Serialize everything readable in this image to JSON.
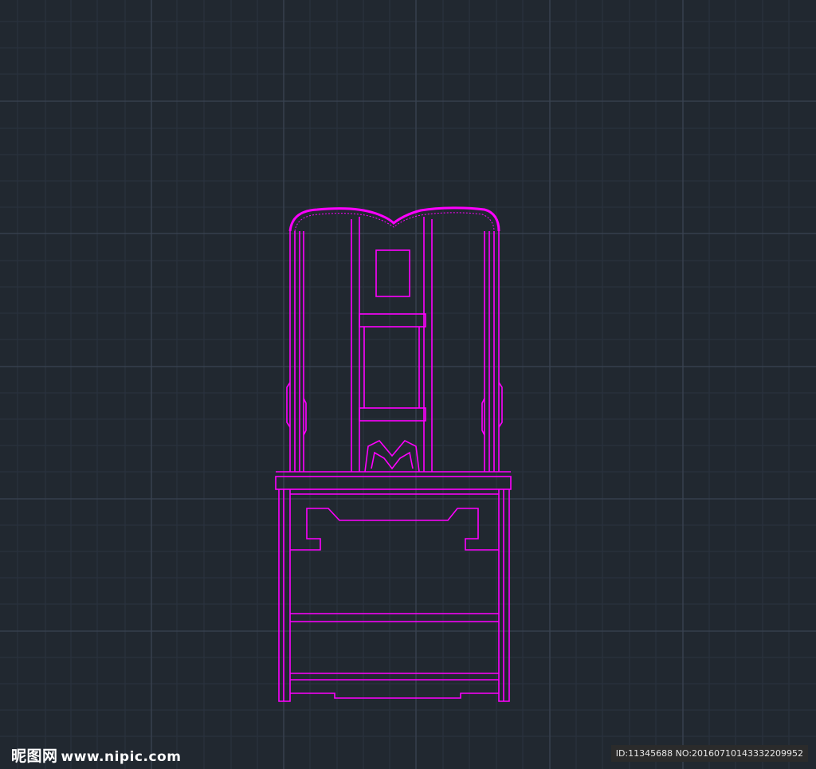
{
  "drawing": {
    "subject": "chair-elevation",
    "background_color": "#212830",
    "line_color": "#ff00ff",
    "grid_minor_color": "#2b3340",
    "grid_major_color": "#3a4352"
  },
  "watermark": {
    "site_cn": "昵图网",
    "site_url": "www.nipic.com",
    "id_text": "ID:11345688 NO:20160710143332209952"
  }
}
